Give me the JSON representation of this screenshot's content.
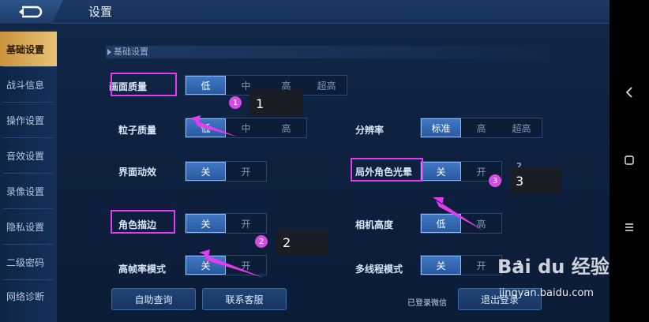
{
  "header": {
    "title": "设置"
  },
  "sidebar": {
    "items": [
      {
        "label": "基础设置",
        "active": true
      },
      {
        "label": "战斗信息"
      },
      {
        "label": "操作设置"
      },
      {
        "label": "音效设置"
      },
      {
        "label": "录像设置"
      },
      {
        "label": "隐私设置"
      },
      {
        "label": "二级密码"
      },
      {
        "label": "网络诊断"
      }
    ]
  },
  "section": {
    "title": "基础设置"
  },
  "settings": {
    "quality": {
      "label": "画面质量",
      "options": [
        "低",
        "中",
        "高",
        "超高"
      ],
      "selected": "低"
    },
    "particle": {
      "label": "粒子质量",
      "options": [
        "低",
        "中",
        "高"
      ],
      "selected": "低"
    },
    "resolution": {
      "label": "分辨率",
      "options": [
        "标准",
        "高",
        "超高"
      ],
      "selected": "标准"
    },
    "ui_anim": {
      "label": "界面动效",
      "options": [
        "关",
        "开"
      ],
      "selected": "关"
    },
    "halo": {
      "label": "局外角色光晕",
      "options": [
        "关",
        "开"
      ],
      "selected": "关",
      "help": "?"
    },
    "outline": {
      "label": "角色描边",
      "options": [
        "关",
        "开"
      ],
      "selected": "关"
    },
    "camera": {
      "label": "相机高度",
      "options": [
        "低",
        "高"
      ],
      "selected": "低"
    },
    "framerate": {
      "label": "高帧率模式",
      "options": [
        "关",
        "开"
      ],
      "selected": "关"
    },
    "multithread": {
      "label": "多线程模式",
      "options": [
        "关",
        "开"
      ],
      "selected": "关",
      "help": "?"
    }
  },
  "annotations": {
    "badge1": "1",
    "num1": "1",
    "badge2": "2",
    "num2": "2",
    "badge3": "3",
    "num3": "3",
    "color": "#e23cf0"
  },
  "footer": {
    "help_button": "自助查询",
    "support_button": "联系客服",
    "login_status": "已登录微信",
    "logout_button": "退出登录"
  },
  "navbar": {
    "back": "back-icon",
    "home": "square-icon",
    "menu": "menu-icon"
  },
  "watermark": {
    "logo": "Bai du 经验",
    "url": "jingyan.baidu.com"
  }
}
